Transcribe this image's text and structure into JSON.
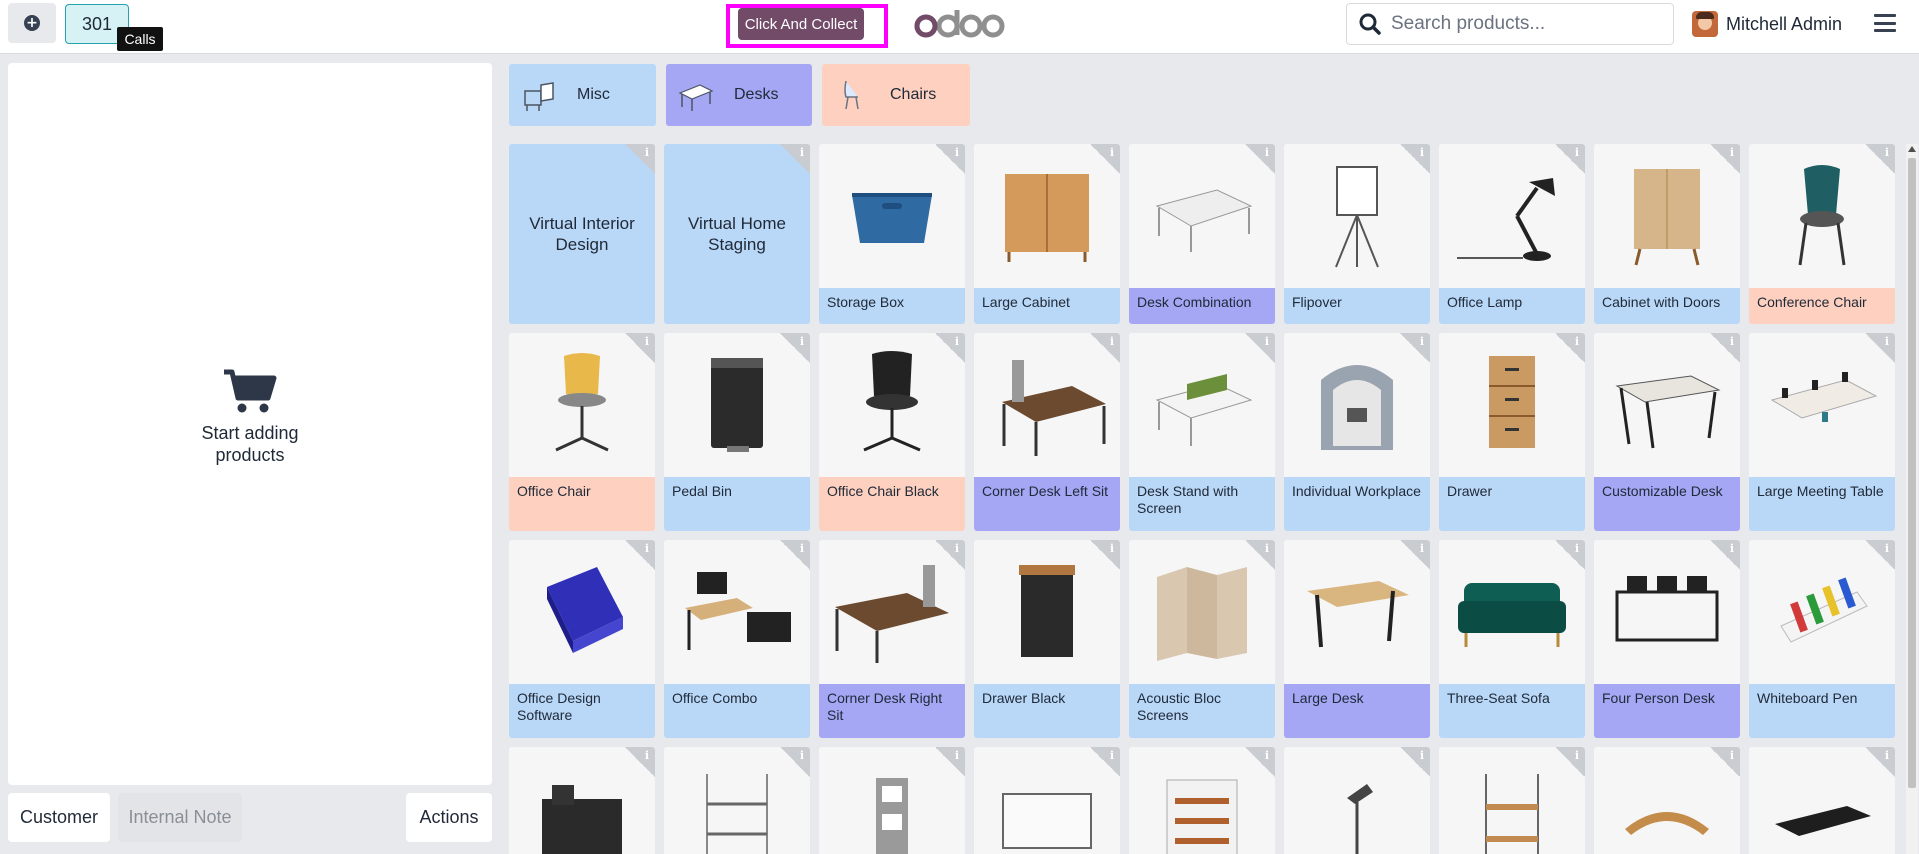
{
  "header": {
    "order_number": "301",
    "tooltip": "Calls",
    "preset_button": "Click And Collect",
    "logo_text": "odoo",
    "search_placeholder": "Search products...",
    "user_name": "Mitchell Admin"
  },
  "order_panel": {
    "empty_text": "Start adding products",
    "customer_button": "Customer",
    "note_button": "Internal Note",
    "actions_button": "Actions"
  },
  "categories": [
    {
      "label": "Misc",
      "color": "#b9d7f7"
    },
    {
      "label": "Desks",
      "color": "#a5a6f4"
    },
    {
      "label": "Chairs",
      "color": "#fdd0c0"
    }
  ],
  "products": [
    {
      "name": "Virtual Interior Design",
      "type": "service"
    },
    {
      "name": "Virtual Home Staging",
      "type": "service"
    },
    {
      "name": "Storage Box",
      "category": "misc"
    },
    {
      "name": "Large Cabinet",
      "category": "misc"
    },
    {
      "name": "Desk Combination",
      "category": "desk"
    },
    {
      "name": "Flipover",
      "category": "misc"
    },
    {
      "name": "Office Lamp",
      "category": "misc"
    },
    {
      "name": "Cabinet with Doors",
      "category": "misc"
    },
    {
      "name": "Conference Chair",
      "category": "chair"
    },
    {
      "name": "Office Chair",
      "category": "chair"
    },
    {
      "name": "Pedal Bin",
      "category": "misc"
    },
    {
      "name": "Office Chair Black",
      "category": "chair"
    },
    {
      "name": "Corner Desk Left Sit",
      "category": "desk"
    },
    {
      "name": "Desk Stand with Screen",
      "category": "misc"
    },
    {
      "name": "Individual Workplace",
      "category": "misc"
    },
    {
      "name": "Drawer",
      "category": "misc"
    },
    {
      "name": "Customizable Desk",
      "category": "desk"
    },
    {
      "name": "Large Meeting Table",
      "category": "misc"
    },
    {
      "name": "Office Design Software",
      "category": "misc"
    },
    {
      "name": "Office Combo",
      "category": "misc"
    },
    {
      "name": "Corner Desk Right Sit",
      "category": "desk"
    },
    {
      "name": "Drawer Black",
      "category": "misc"
    },
    {
      "name": "Acoustic Bloc Screens",
      "category": "misc"
    },
    {
      "name": "Large Desk",
      "category": "desk"
    },
    {
      "name": "Three-Seat Sofa",
      "category": "misc"
    },
    {
      "name": "Four Person Desk",
      "category": "desk"
    },
    {
      "name": "Whiteboard Pen",
      "category": "misc"
    }
  ],
  "partial_row_icons": [
    "desk-organizer-icon",
    "shelf-icon",
    "magazine-rack-icon",
    "whiteboard-icon",
    "shelving-unit-icon",
    "desk-lamp-icon",
    "wooden-shelf-icon",
    "monitor-stand-icon",
    "desk-pad-icon"
  ],
  "colors": {
    "accent": "#714b67",
    "highlight": "#ff00ff",
    "order_tab": "#d7f2f5"
  }
}
